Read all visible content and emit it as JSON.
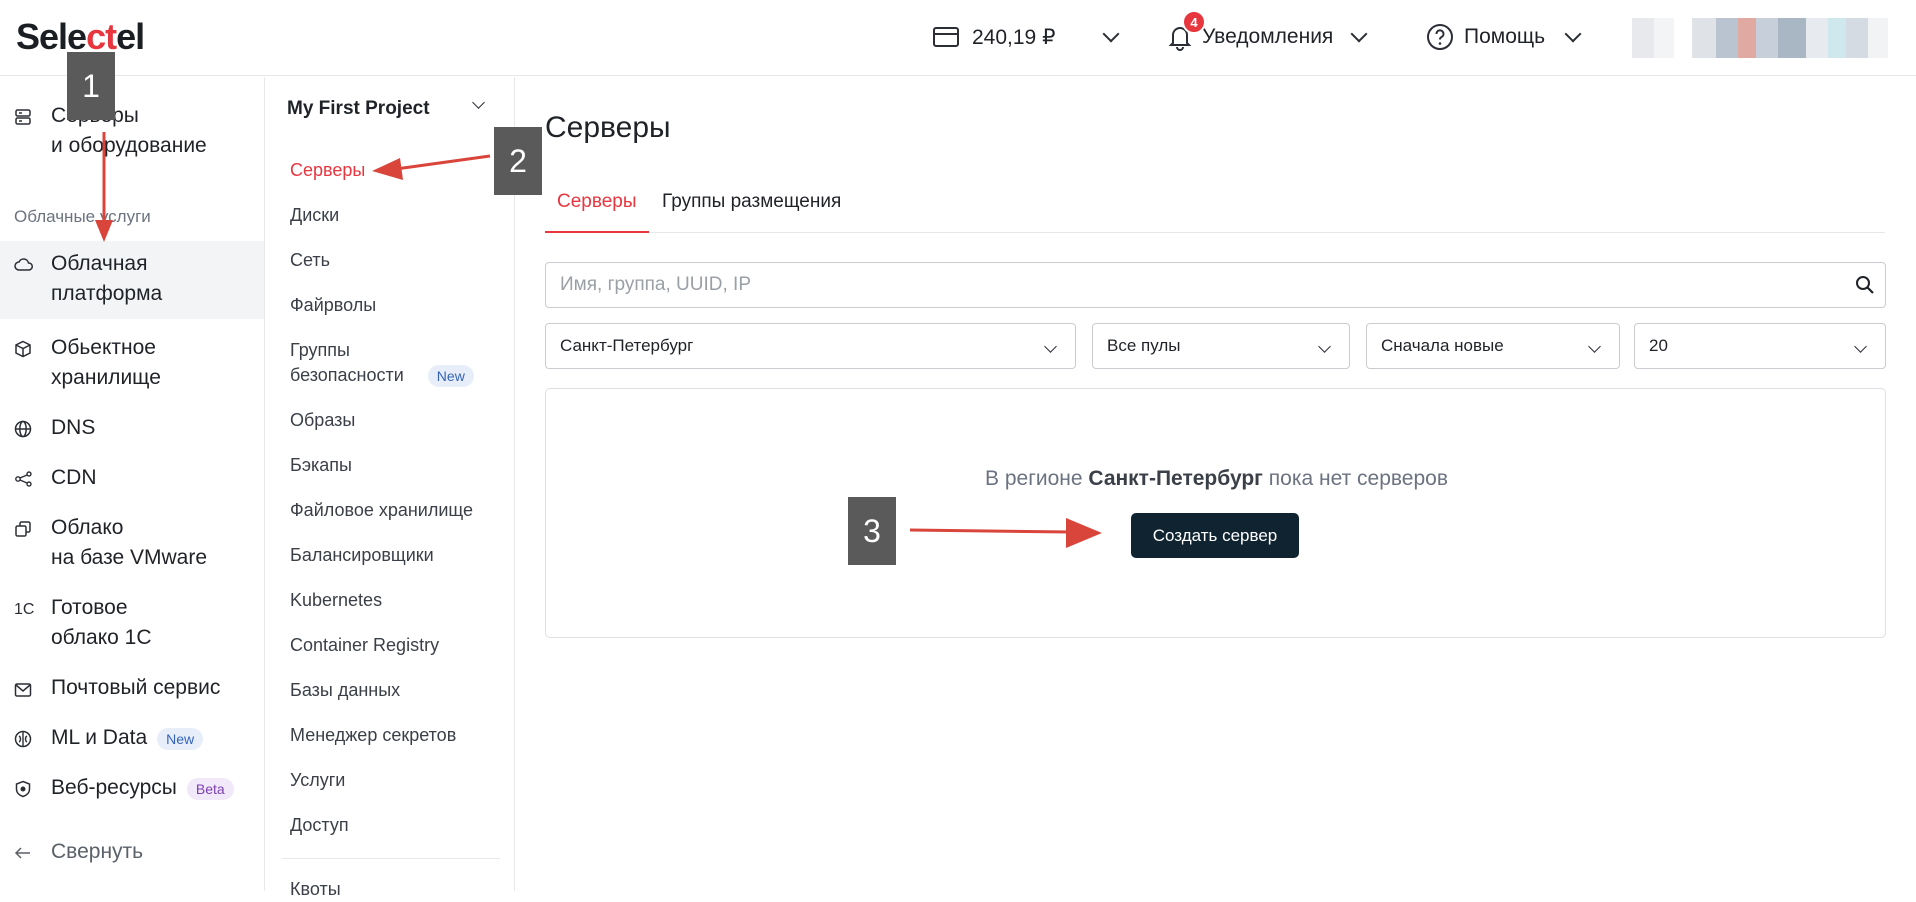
{
  "header": {
    "logo_part1": "Sele",
    "logo_part2": "ct",
    "logo_part3": "el",
    "balance": "240,19 ₽",
    "notifications_label": "Уведомления",
    "notifications_count": "4",
    "help_label": "Помощь"
  },
  "sidebar": {
    "section_label": "Облачные услуги",
    "items": [
      {
        "line1": "Серверы",
        "line2": "и оборудование",
        "icon": "server-icon"
      },
      {
        "line1": "Облачная",
        "line2": "платформа",
        "icon": "cloud-icon"
      },
      {
        "line1": "Обьектное",
        "line2": "хранилище",
        "icon": "box-icon"
      },
      {
        "line1": "DNS",
        "line2": "",
        "icon": "globe-icon"
      },
      {
        "line1": "CDN",
        "line2": "",
        "icon": "network-icon"
      },
      {
        "line1": "Облако",
        "line2": "на базе VMware",
        "icon": "copy-icon"
      },
      {
        "line1": "Готовое",
        "line2": "облако 1С",
        "icon": "1c-icon",
        "icon_text": "1C"
      },
      {
        "line1": "Почтовый сервис",
        "line2": "",
        "icon": "mail-icon"
      },
      {
        "line1": "ML и Data",
        "line2": "",
        "icon": "brain-icon",
        "badge": "New"
      },
      {
        "line1": "Веб-ресурсы",
        "line2": "",
        "icon": "shield-icon",
        "badge": "Beta"
      }
    ],
    "collapse_label": "Свернуть"
  },
  "subnav": {
    "project_name": "My First Project",
    "items": [
      "Серверы",
      "Диски",
      "Сеть",
      "Файрволы",
      "Группы",
      "Образы",
      "Бэкапы",
      "Файловое хранилище",
      "Балансировщики",
      "Kubernetes",
      "Container Registry",
      "Базы данных",
      "Менеджер секретов",
      "Услуги",
      "Доступ",
      "Квоты"
    ],
    "security_line2": "безопасности",
    "security_badge": "New"
  },
  "main": {
    "title": "Серверы",
    "tabs": [
      "Серверы",
      "Группы размещения"
    ],
    "search_placeholder": "Имя, группа, UUID, IP",
    "filters": {
      "region": "Санкт-Петербург",
      "pool": "Все пулы",
      "sort": "Сначала новые",
      "per_page": "20"
    },
    "empty_prefix": "В регионе ",
    "empty_region": "Санкт-Петербург",
    "empty_suffix": " пока нет серверов",
    "create_button": "Создать сервер"
  },
  "callouts": [
    "1",
    "2",
    "3"
  ],
  "colors": {
    "accent": "#e8363f",
    "dark_button": "#0f2330",
    "callout_bg": "#5a5a5a",
    "arrow": "#d9453b"
  }
}
